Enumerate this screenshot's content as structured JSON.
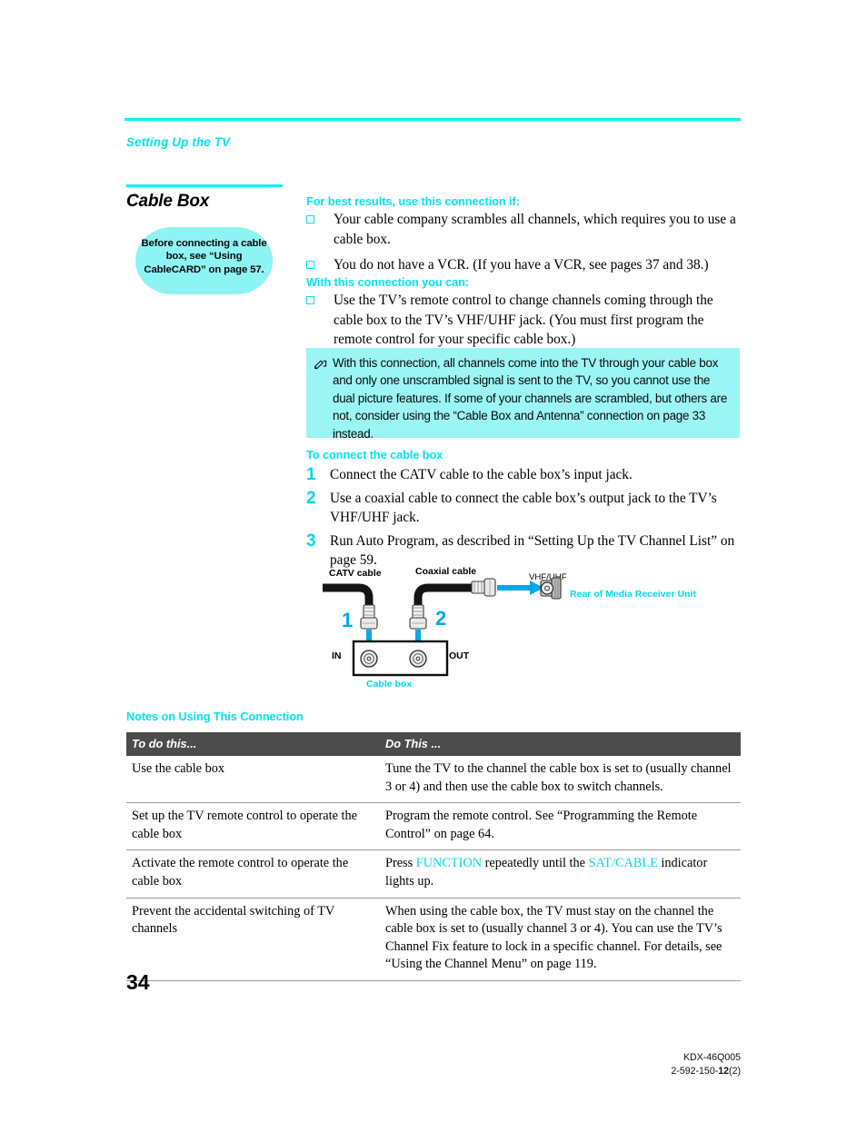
{
  "colors": {
    "accent_cyan": "#00e4f0",
    "note_bg": "#9cf5f5",
    "callout_bg": "#8ef3f3",
    "table_header_bg": "#4c4c4c",
    "diagram_blue": "#00a8e8"
  },
  "header": {
    "running_head": "Setting Up the TV"
  },
  "section": {
    "title": "Cable Box",
    "callout": "Before connecting a cable box, see “Using CableCARD” on page 57."
  },
  "best_results": {
    "heading": "For best results, use this connection if:",
    "items": [
      "Your cable company scrambles all channels, which requires you to use a cable box.",
      "You do not have a VCR. (If you have a VCR, see pages 37 and 38.)"
    ]
  },
  "with_connection": {
    "heading": "With this connection you can:",
    "items": [
      "Use the TV’s remote control to change channels coming through the cable box to the TV’s VHF/UHF jack. (You must first program the remote control for your specific cable box.)"
    ]
  },
  "note": {
    "icon": "note-pencil-icon",
    "text": "With this connection, all channels come into the TV through your cable box and only one unscrambled signal is sent to the TV, so you cannot use the dual picture features. If some of your channels are scrambled, but others are not, consider using the “Cable Box and Antenna” connection on page 33 instead."
  },
  "to_connect": {
    "heading": "To connect the cable box",
    "steps": [
      {
        "num": "1",
        "text": "Connect the CATV cable to the cable box’s input jack."
      },
      {
        "num": "2",
        "text": "Use a coaxial cable to connect the cable box’s output jack to the TV’s VHF/UHF jack."
      },
      {
        "num": "3",
        "text": "Run Auto Program, as described in “Setting Up the TV Channel List” on page 59."
      }
    ]
  },
  "diagram": {
    "catv_cable_label": "CATV cable",
    "coaxial_cable_label": "Coaxial cable",
    "vhf_uhf_label": "VHF/UHF",
    "rear_unit_label": "Rear of Media Receiver Unit",
    "in_label": "IN",
    "out_label": "OUT",
    "cable_box_label": "Cable box",
    "callout_number_1": "1",
    "callout_number_2": "2"
  },
  "notes_table": {
    "heading": "Notes on Using This Connection",
    "columns": [
      "To do this...",
      "Do This ..."
    ],
    "rows": [
      {
        "todo": "Use the cable box",
        "dothis_pre": "Tune the TV to the channel the cable box is set to (usually channel 3 or 4) and then use the cable box to switch channels.",
        "kw1": "",
        "dothis_mid": "",
        "kw2": "",
        "dothis_post": ""
      },
      {
        "todo": "Set up the TV remote control to operate the cable box",
        "dothis_pre": "Program the remote control. See “Programming the Remote Control” on page 64.",
        "kw1": "",
        "dothis_mid": "",
        "kw2": "",
        "dothis_post": ""
      },
      {
        "todo": "Activate the remote control to operate the cable box",
        "dothis_pre": "Press ",
        "kw1": "FUNCTION",
        "dothis_mid": " repeatedly until the ",
        "kw2": "SAT/CABLE",
        "dothis_post": " indicator lights up."
      },
      {
        "todo": "Prevent the accidental switching of TV channels",
        "dothis_pre": "When using the cable box, the TV must stay on the channel the cable box is set to (usually channel 3 or 4). You can use the TV’s Channel Fix feature to lock in a specific channel. For details, see “Using the Channel Menu” on page 119.",
        "kw1": "",
        "dothis_mid": "",
        "kw2": "",
        "dothis_post": ""
      }
    ]
  },
  "footer": {
    "page_number": "34",
    "model_code": "KDX-46Q005",
    "doc_code_pre": "2-592-150-",
    "doc_code_bold": "12",
    "doc_code_post": "(2)"
  }
}
